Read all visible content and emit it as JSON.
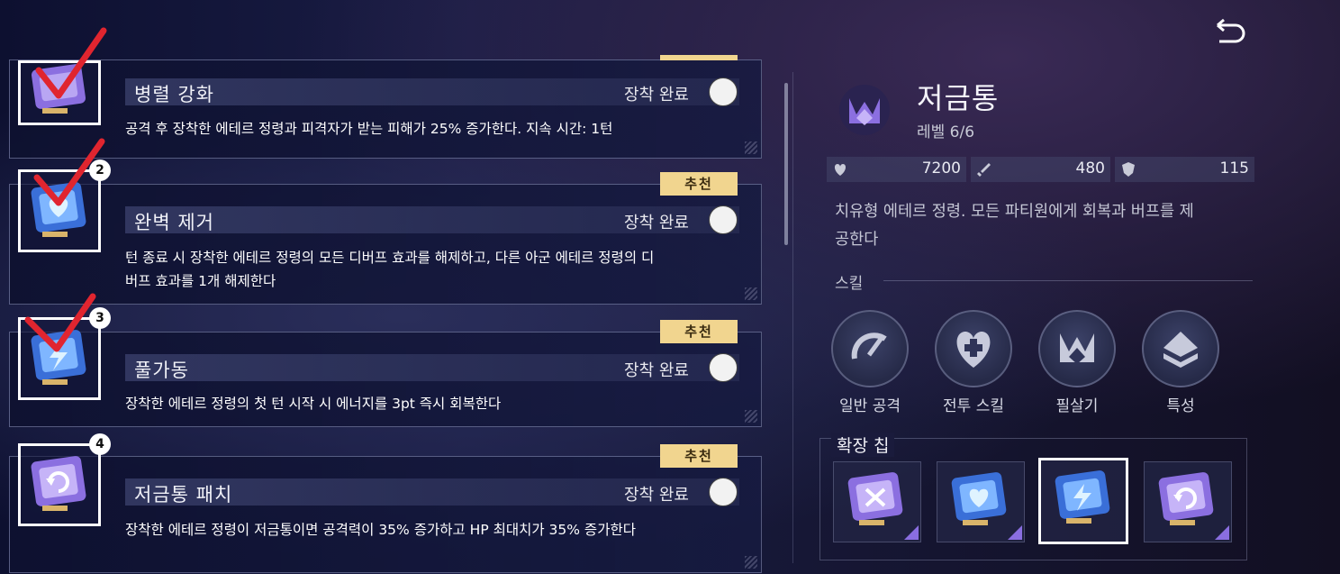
{
  "ui": {
    "back_icon": "undo-arrow-icon"
  },
  "chips": [
    {
      "number": "",
      "name": "병렬 강화",
      "recommended": false,
      "equip_label": "장착 완료",
      "description_lines": [
        "공격 후 장착한 에테르 정령과 피격자가 받는 피해가 25% 증가한다. 지속 시간: 1턴"
      ],
      "icon": "sword-chip-icon",
      "chip_color": "#8b6fe0",
      "checked": true
    },
    {
      "number": "2",
      "name": "완벽 제거",
      "recommended": true,
      "recommended_label": "추천",
      "equip_label": "장착 완료",
      "description_lines": [
        "턴 종료 시 장착한 에테르 정령의 모든 디버프 효과를 해제하고, 다른 아군 에테르 정령의 디",
        "버프 효과를 1개 해제한다"
      ],
      "icon": "heart-chip-icon",
      "chip_color": "#3a6fd8",
      "checked": true
    },
    {
      "number": "3",
      "name": "풀가동",
      "recommended": true,
      "recommended_label": "추천",
      "equip_label": "장착 완료",
      "description_lines": [
        "장착한 에테르 정령의 첫 턴 시작 시 에너지를 3pt 즉시 회복한다"
      ],
      "icon": "lightning-chip-icon",
      "chip_color": "#3a6fd8",
      "checked": true
    },
    {
      "number": "4",
      "name": "저금통 패치",
      "recommended": true,
      "recommended_label": "추천",
      "equip_label": "장착 완료",
      "description_lines": [
        "장착한 에테르 정령이 저금통이면 공격력이 35% 증가하고 HP 최대치가 35% 증가한다"
      ],
      "icon": "refresh-chip-icon",
      "chip_color": "#8b6fe0",
      "checked": false
    }
  ],
  "spirit": {
    "name": "저금통",
    "level": "레벨 6/6",
    "icon": "crown-emblem-icon",
    "stats": [
      {
        "icon": "heart-icon",
        "value": "7200"
      },
      {
        "icon": "sword-icon",
        "value": "480"
      },
      {
        "icon": "shield-icon",
        "value": "115"
      }
    ],
    "description_lines": [
      "치유형 에테르 정령. 모든 파티원에게 회복과 버프를 제",
      "공한다"
    ],
    "skills_title": "스킬",
    "skills": [
      {
        "label": "일반 공격",
        "icon": "basic-attack-icon"
      },
      {
        "label": "전투 스킬",
        "icon": "heal-skill-icon"
      },
      {
        "label": "필살기",
        "icon": "ultimate-icon"
      },
      {
        "label": "특성",
        "icon": "trait-icon"
      }
    ],
    "extension_title": "확장 칩",
    "extension_chips": [
      {
        "icon": "sword-chip-icon",
        "selected": false
      },
      {
        "icon": "heart-chip-icon",
        "selected": false
      },
      {
        "icon": "lightning-chip-icon",
        "selected": true
      },
      {
        "icon": "refresh-chip-icon",
        "selected": false
      }
    ]
  },
  "colors": {
    "recommended_badge": "#f1d58f",
    "check_mark": "#e0252f",
    "chip_purple": "#8b6fe0",
    "chip_blue": "#3a6fd8"
  }
}
